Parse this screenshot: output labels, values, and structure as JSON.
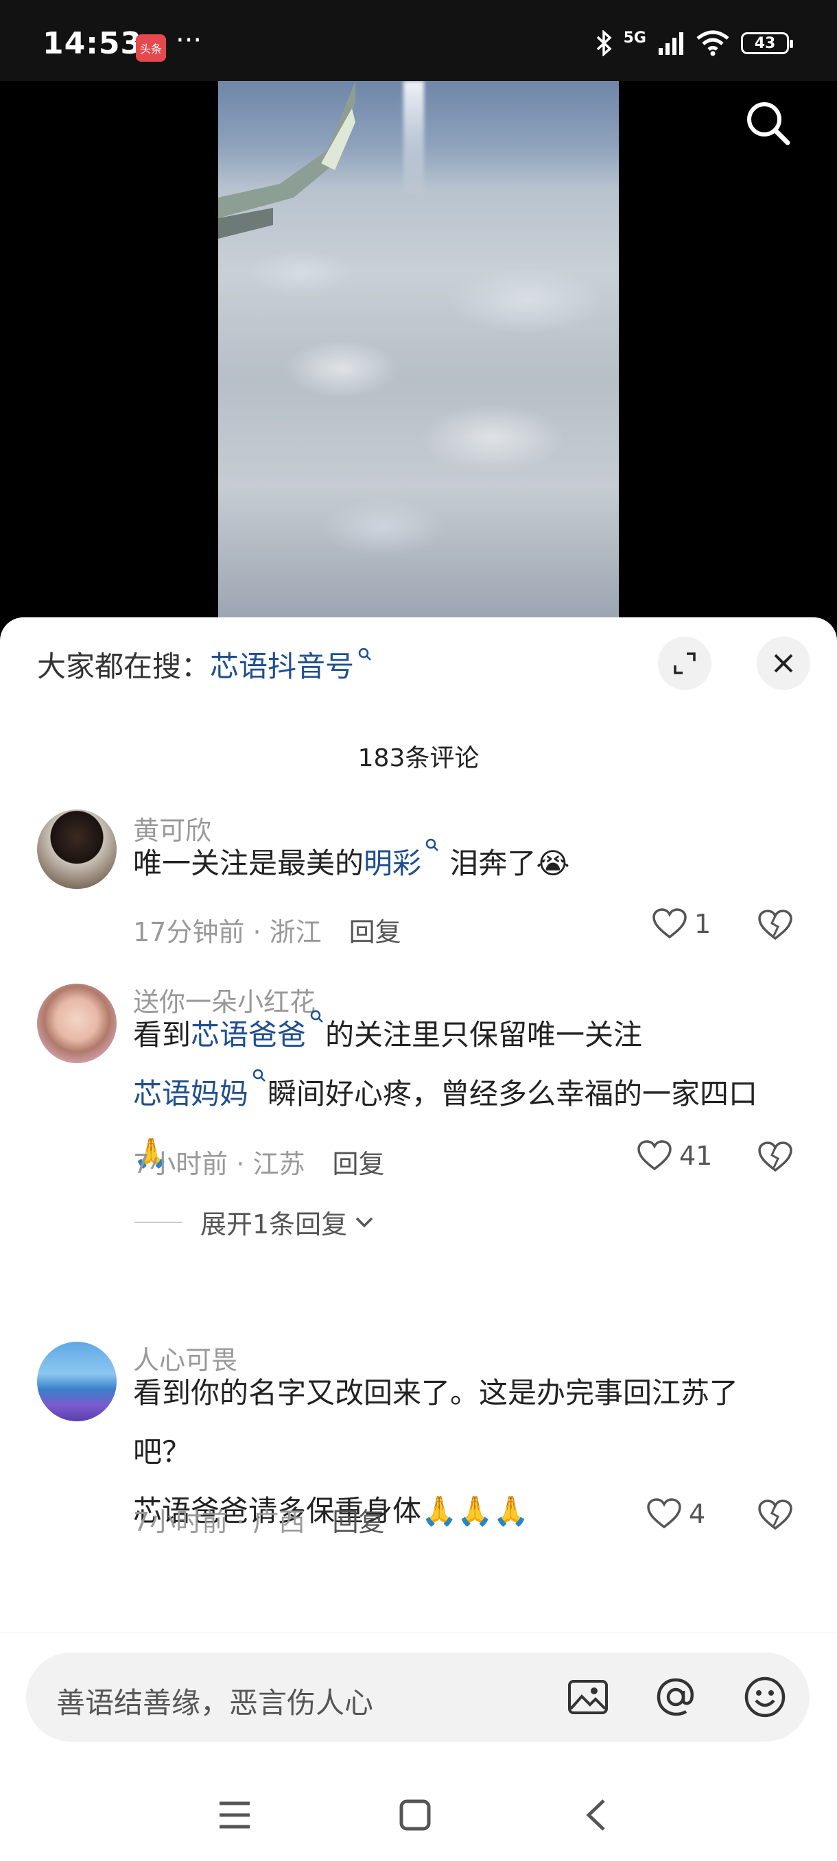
{
  "status": {
    "time": "14:53",
    "app_badge": "头条",
    "more": "···",
    "network": "5G",
    "battery": "43"
  },
  "search_bar": {
    "prefix": "大家都在搜：",
    "keyword": "芯语抖音号"
  },
  "comments_count": "183条评论",
  "comments": [
    {
      "user": "黄可欣",
      "text_parts": [
        "唯一关注是最美的",
        "明彩",
        " 泪奔了😭"
      ],
      "time": "17分钟前",
      "location": "浙江",
      "reply_label": "回复",
      "likes": "1"
    },
    {
      "user": "送你一朵小红花",
      "text_parts": [
        "看到",
        "芯语爸爸",
        "的关注里只保留唯一关注",
        "芯语妈妈",
        "瞬间好心疼，曾经多么幸福的一家四口🙏"
      ],
      "time": "7小时前",
      "location": "江苏",
      "reply_label": "回复",
      "likes": "41",
      "expand": "展开1条回复"
    },
    {
      "user": "人心可畏",
      "text_line1": "看到你的名字又改回来了。这是办完事回江苏了吧？",
      "text_line2": "芯语爸爸请多保重身体🙏🙏🙏",
      "time": "7小时前",
      "location": "广西",
      "reply_label": "回复",
      "likes": "4"
    }
  ],
  "input": {
    "placeholder": "善语结善缘，恶言伤人心"
  },
  "colors": {
    "link": "#1f4f8f",
    "meta": "#999999",
    "background": "#ffffff"
  },
  "icons": [
    "search-icon",
    "expand-icon",
    "close-icon",
    "heart-icon",
    "dislike-icon",
    "image-icon",
    "at-icon",
    "emoji-icon",
    "menu-icon",
    "home-icon",
    "back-icon"
  ]
}
